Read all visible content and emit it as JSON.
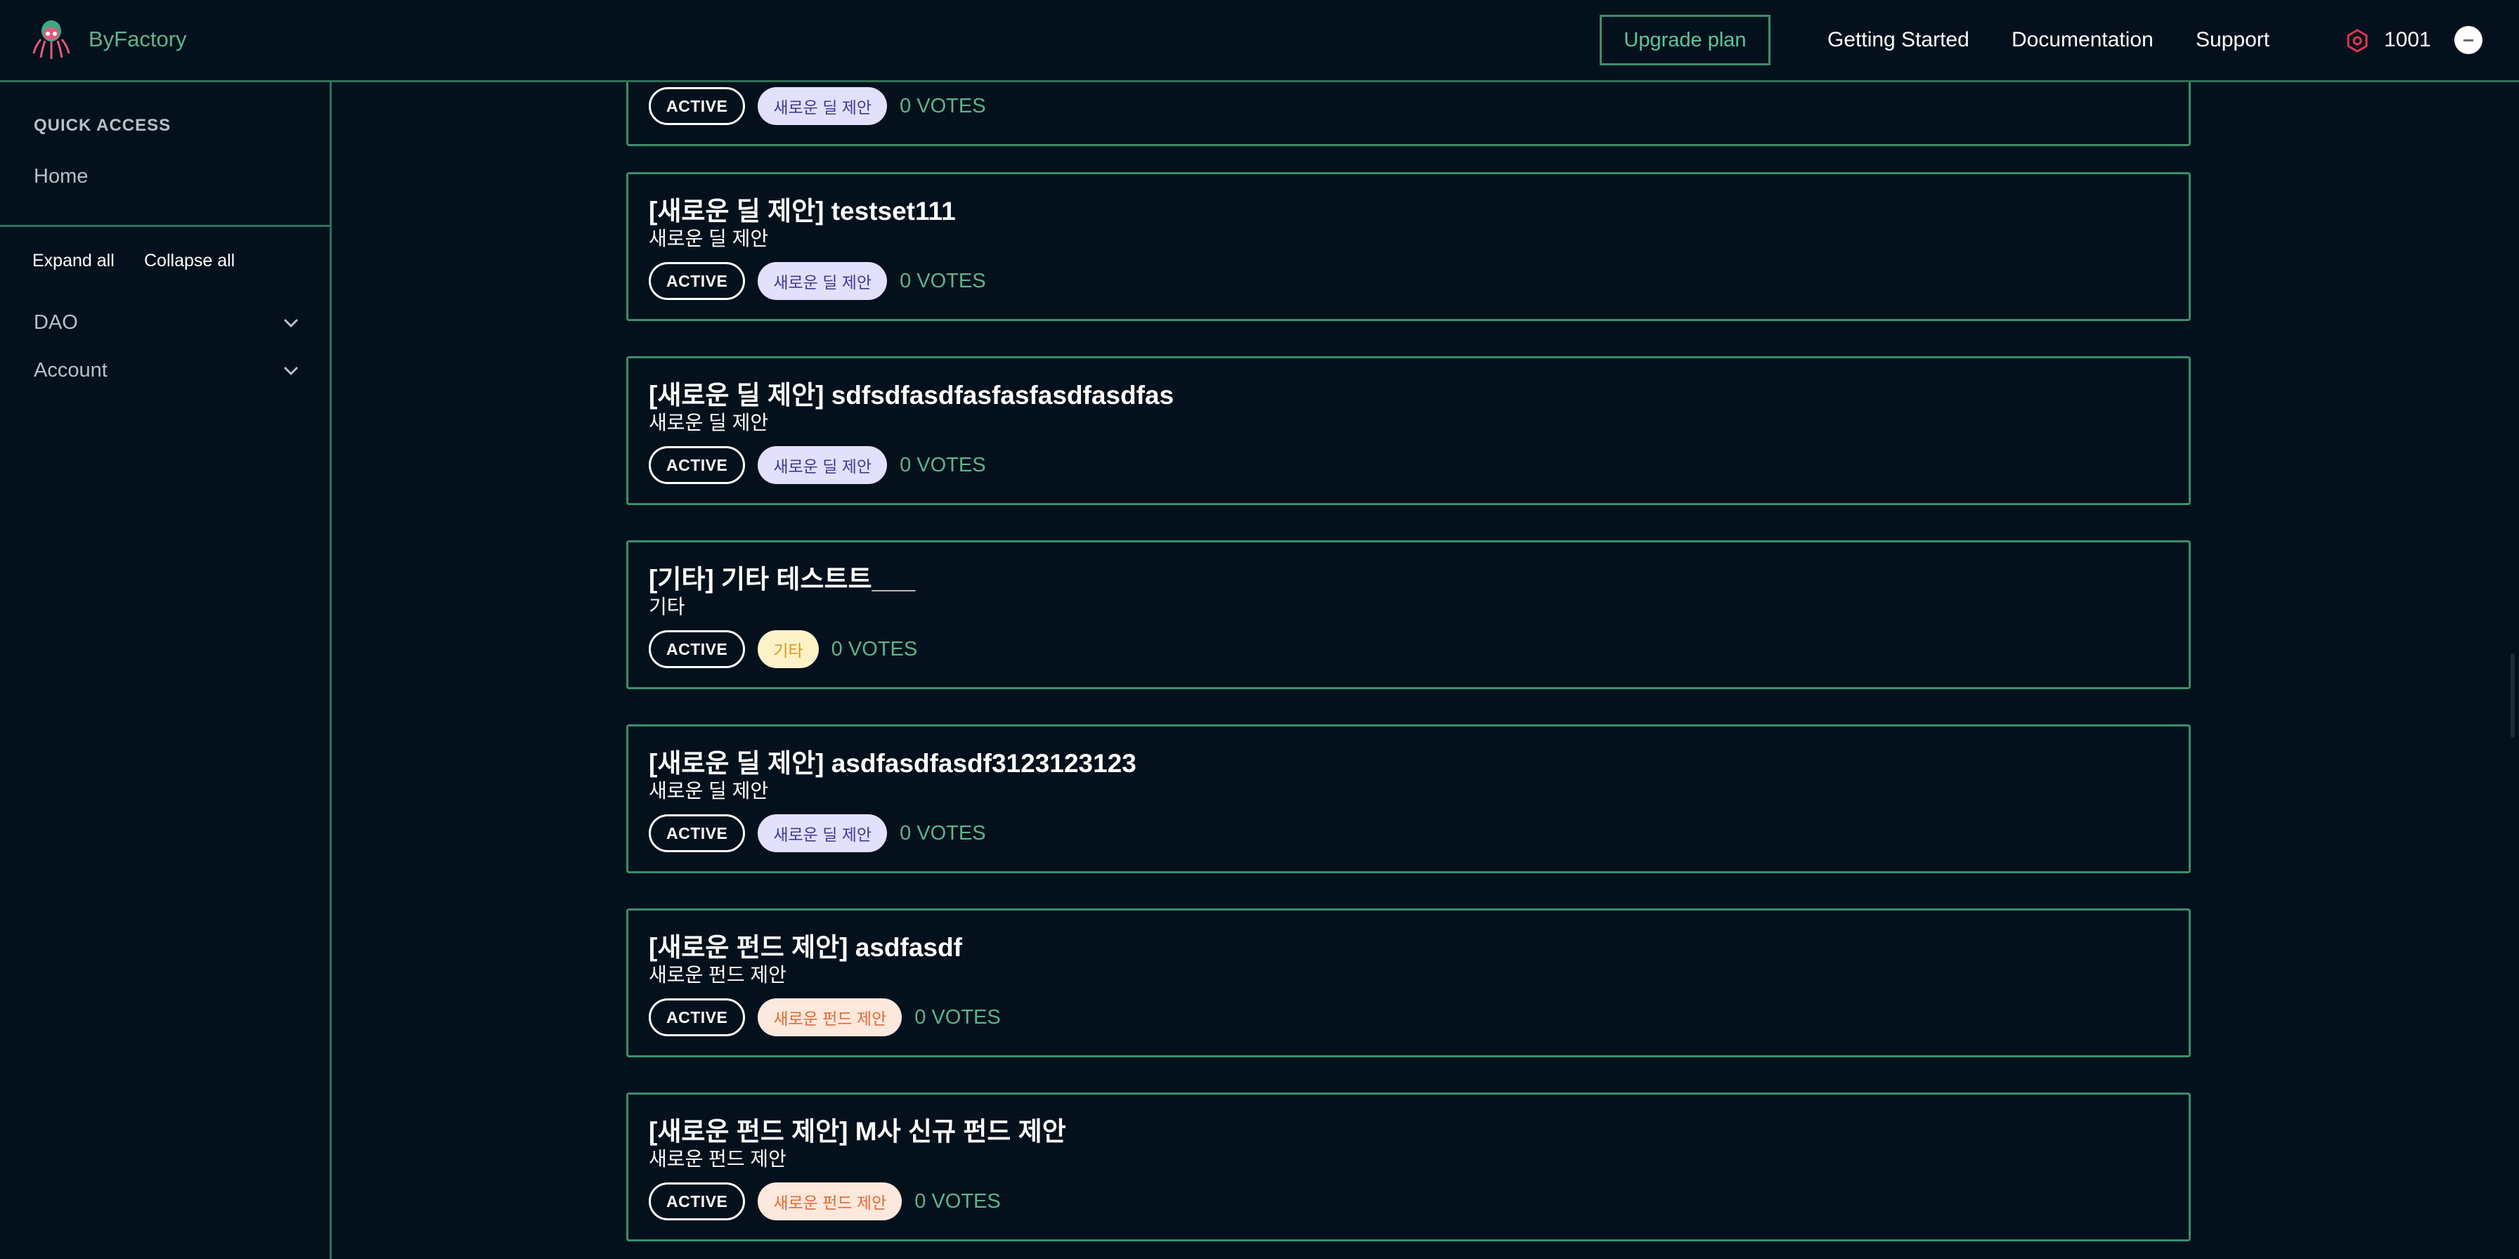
{
  "header": {
    "brand": "ByFactory",
    "upgrade_label": "Upgrade plan",
    "nav": [
      "Getting Started",
      "Documentation",
      "Support"
    ],
    "credits": "1001"
  },
  "sidebar": {
    "quick_access_title": "QUICK ACCESS",
    "home_label": "Home",
    "expand_all": "Expand all",
    "collapse_all": "Collapse all",
    "items": [
      {
        "label": "DAO",
        "icon": "chevron-down-icon"
      },
      {
        "label": "Account",
        "icon": "chevron-down-icon"
      }
    ]
  },
  "proposals": [
    {
      "title": "",
      "subtitle": "",
      "status": "ACTIVE",
      "category": "새로운 딜 제안",
      "votes": "0 VOTES"
    },
    {
      "title": "[새로운 딜 제안] testset111",
      "subtitle": "새로운 딜 제안",
      "status": "ACTIVE",
      "category": "새로운 딜 제안",
      "votes": "0 VOTES"
    },
    {
      "title": "[새로운 딜 제안] sdfsdfasdfasfasfasdfasdfas",
      "subtitle": "새로운 딜 제안",
      "status": "ACTIVE",
      "category": "새로운 딜 제안",
      "votes": "0 VOTES"
    },
    {
      "title": "[기타] 기타 테스트트___",
      "subtitle": "기타",
      "status": "ACTIVE",
      "category": "기타",
      "votes": "0 VOTES"
    },
    {
      "title": "[새로운 딜 제안] asdfasdfasdf3123123123",
      "subtitle": "새로운 딜 제안",
      "status": "ACTIVE",
      "category": "새로운 딜 제안",
      "votes": "0 VOTES"
    },
    {
      "title": "[새로운 펀드 제안] asdfasdf",
      "subtitle": "새로운 펀드 제안",
      "status": "ACTIVE",
      "category": "새로운 펀드 제안",
      "votes": "0 VOTES"
    },
    {
      "title": "[새로운 펀드 제안] M사 신규 펀드 제안",
      "subtitle": "새로운 펀드 제안",
      "status": "ACTIVE",
      "category": "새로운 펀드 제안",
      "votes": "0 VOTES"
    }
  ],
  "colors": {
    "background": "#04111c",
    "accent_green": "#3a8f6c",
    "deal_badge_bg": "#e2e0fa",
    "etc_badge_bg": "#fdf1c8",
    "fund_badge_bg": "#fde8dd"
  }
}
